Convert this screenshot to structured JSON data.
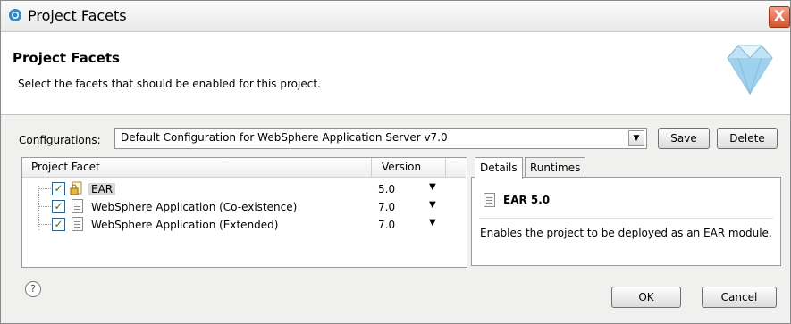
{
  "window": {
    "title": "Project Facets",
    "close_glyph": "X"
  },
  "banner": {
    "title": "Project Facets",
    "subtitle": "Select the facets that should be enabled for this project."
  },
  "configurations": {
    "label": "Configurations:",
    "selected": "Default Configuration for WebSphere Application Server v7.0",
    "save_label": "Save",
    "delete_label": "Delete"
  },
  "facet_table": {
    "columns": [
      "Project Facet",
      "Version"
    ],
    "rows": [
      {
        "name": "EAR",
        "version": "5.0",
        "checked": true,
        "icon": "ear-lock-icon"
      },
      {
        "name": "WebSphere Application (Co-existence)",
        "version": "7.0",
        "checked": true,
        "icon": "document-icon"
      },
      {
        "name": "WebSphere Application (Extended)",
        "version": "7.0",
        "checked": true,
        "icon": "document-icon"
      }
    ]
  },
  "details": {
    "tabs": [
      "Details",
      "Runtimes"
    ],
    "active_tab": "Details",
    "title": "EAR 5.0",
    "description": "Enables the project to be deployed as an EAR module."
  },
  "footer": {
    "help_glyph": "?",
    "ok_label": "OK",
    "cancel_label": "Cancel"
  },
  "colors": {
    "close_button": "#d3532b",
    "dialog_background": "#f0f0ee",
    "checkbox_border": "#2c628b"
  }
}
